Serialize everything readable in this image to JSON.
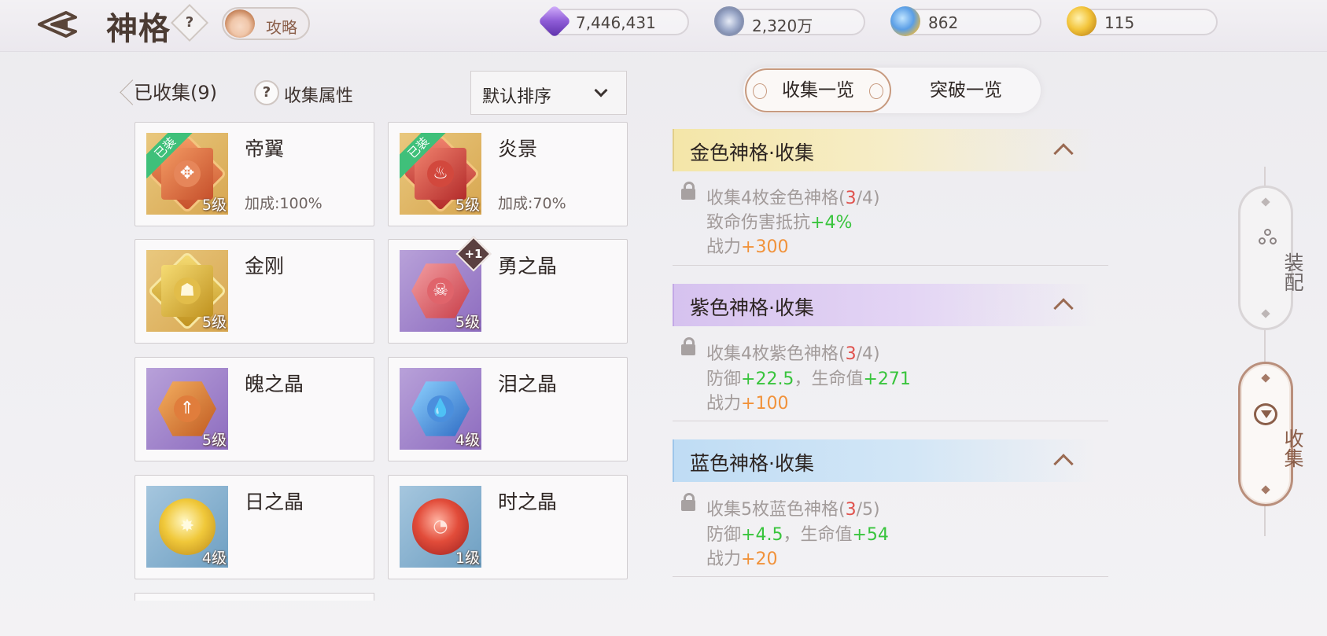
{
  "header": {
    "title": "神格",
    "help_label": "?",
    "guide_label": "攻略",
    "currencies": [
      {
        "icon": "purple-crystal-icon",
        "value": "7,446,431"
      },
      {
        "icon": "silver-coin-icon",
        "value": "2,320万"
      },
      {
        "icon": "blue-orb-icon",
        "value": "862"
      },
      {
        "icon": "gold-orb-icon",
        "value": "115"
      }
    ]
  },
  "left": {
    "collected_label": "已收集(9)",
    "attr_help": "?",
    "attr_label": "收集属性",
    "sort_label": "默认排序",
    "cards": [
      {
        "name": "帝翼",
        "level": "5级",
        "bonus": "加成:100%",
        "equipped": "已装",
        "icon": "wing-gem-icon"
      },
      {
        "name": "炎景",
        "level": "5级",
        "bonus": "加成:70%",
        "equipped": "已装",
        "icon": "flame-gem-icon"
      },
      {
        "name": "金刚",
        "level": "5级",
        "icon": "guardian-gem-icon"
      },
      {
        "name": "勇之晶",
        "level": "5级",
        "badge": "+1",
        "icon": "beast-gem-icon"
      },
      {
        "name": "魄之晶",
        "level": "5级",
        "icon": "arrow-gem-icon"
      },
      {
        "name": "泪之晶",
        "level": "4级",
        "icon": "water-gem-icon"
      },
      {
        "name": "日之晶",
        "level": "4级",
        "icon": "sun-gem-icon"
      },
      {
        "name": "时之晶",
        "level": "1级",
        "icon": "time-gem-icon"
      }
    ]
  },
  "right": {
    "tabs": [
      "收集一览",
      "突破一览"
    ],
    "sections": [
      {
        "title": "金色神格·收集",
        "req_prefix": "收集4枚金色神格(",
        "req_have": "3",
        "req_total": "/4)",
        "stats": [
          {
            "label": "致命伤害抵抗",
            "value": "+4%"
          }
        ],
        "power_label": "战力",
        "power": "+300"
      },
      {
        "title": "紫色神格·收集",
        "req_prefix": "收集4枚紫色神格(",
        "req_have": "3",
        "req_total": "/4)",
        "stats": [
          {
            "label": "防御",
            "value": "+22.5"
          },
          {
            "label": "，生命值",
            "value": "+271"
          }
        ],
        "power_label": "战力",
        "power": "+100"
      },
      {
        "title": "蓝色神格·收集",
        "req_prefix": "收集5枚蓝色神格(",
        "req_have": "3",
        "req_total": "/5)",
        "stats": [
          {
            "label": "防御",
            "value": "+4.5"
          },
          {
            "label": "，生命值",
            "value": "+54"
          }
        ],
        "power_label": "战力",
        "power": "+20"
      }
    ]
  },
  "side_tabs": [
    {
      "label": "装配",
      "icon": "three-circles-icon"
    },
    {
      "label": "收集",
      "icon": "emblem-icon"
    }
  ]
}
